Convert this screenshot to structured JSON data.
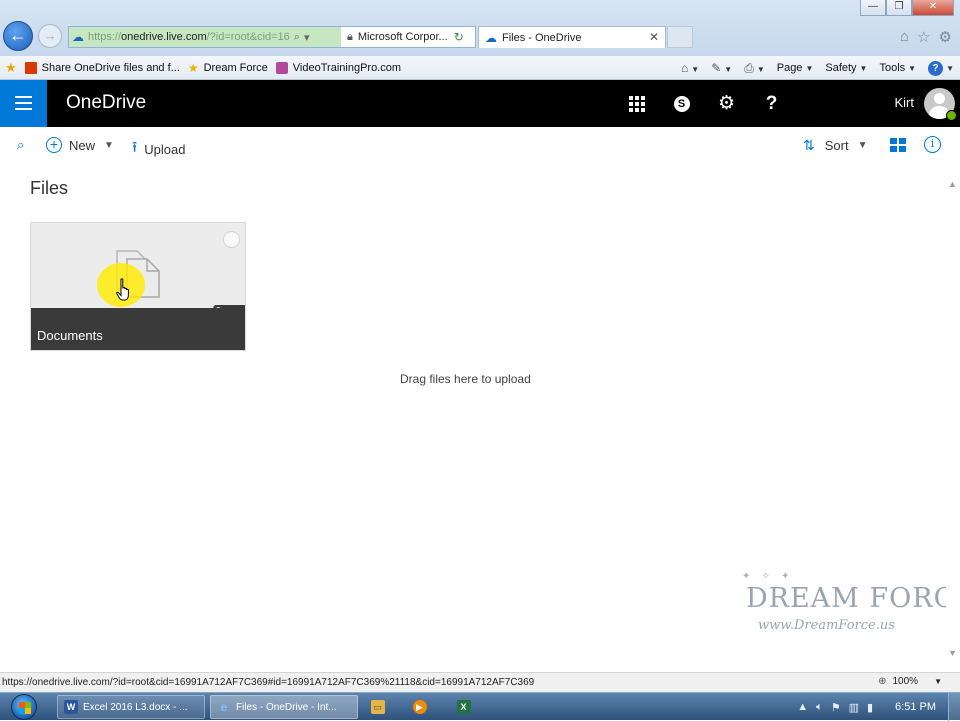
{
  "browser": {
    "window_buttons": {
      "minimize": "—",
      "restore": "❐",
      "close": "✕"
    },
    "nav": {
      "back_icon": "arrow-left-icon",
      "forward_icon": "arrow-right-icon"
    },
    "address": {
      "url_prefix": "https://",
      "url_host": "onedrive.live.com",
      "url_tail": "/?id=root&cid=16",
      "certificate_label": "Microsoft Corpor..."
    },
    "tabs": [
      {
        "label": "Files - OneDrive",
        "active": true
      }
    ],
    "favorites": [
      {
        "label": "Share OneDrive files and f...",
        "icon": "office-icon"
      },
      {
        "label": "Dream Force",
        "icon": "star-icon"
      },
      {
        "label": "VideoTrainingPro.com",
        "icon": "site-icon"
      }
    ],
    "commands": {
      "page": "Page",
      "safety": "Safety",
      "tools": "Tools"
    },
    "status_url": "https://onedrive.live.com/?id=root&cid=16991A712AF7C369#id=16991A712AF7C369%21118&cid=16991A712AF7C369",
    "zoom": "100%"
  },
  "onedrive": {
    "brand": "OneDrive",
    "user_name": "Kirt",
    "accent": "#0078d7",
    "toolbar": {
      "new_label": "New",
      "upload_label": "Upload",
      "sort_label": "Sort"
    },
    "page_title": "Files",
    "folders": [
      {
        "name": "Documents",
        "count": "10"
      }
    ],
    "drag_hint": "Drag files here to upload"
  },
  "watermark": {
    "brand": "DREAM FORCE",
    "url": "www.DreamForce.us"
  },
  "taskbar": {
    "items": [
      {
        "label": "Excel 2016 L3.docx - ...",
        "icon": "word-icon"
      },
      {
        "label": "Files - OneDrive - Int...",
        "icon": "ie-icon"
      }
    ],
    "clock": "6:51 PM"
  }
}
